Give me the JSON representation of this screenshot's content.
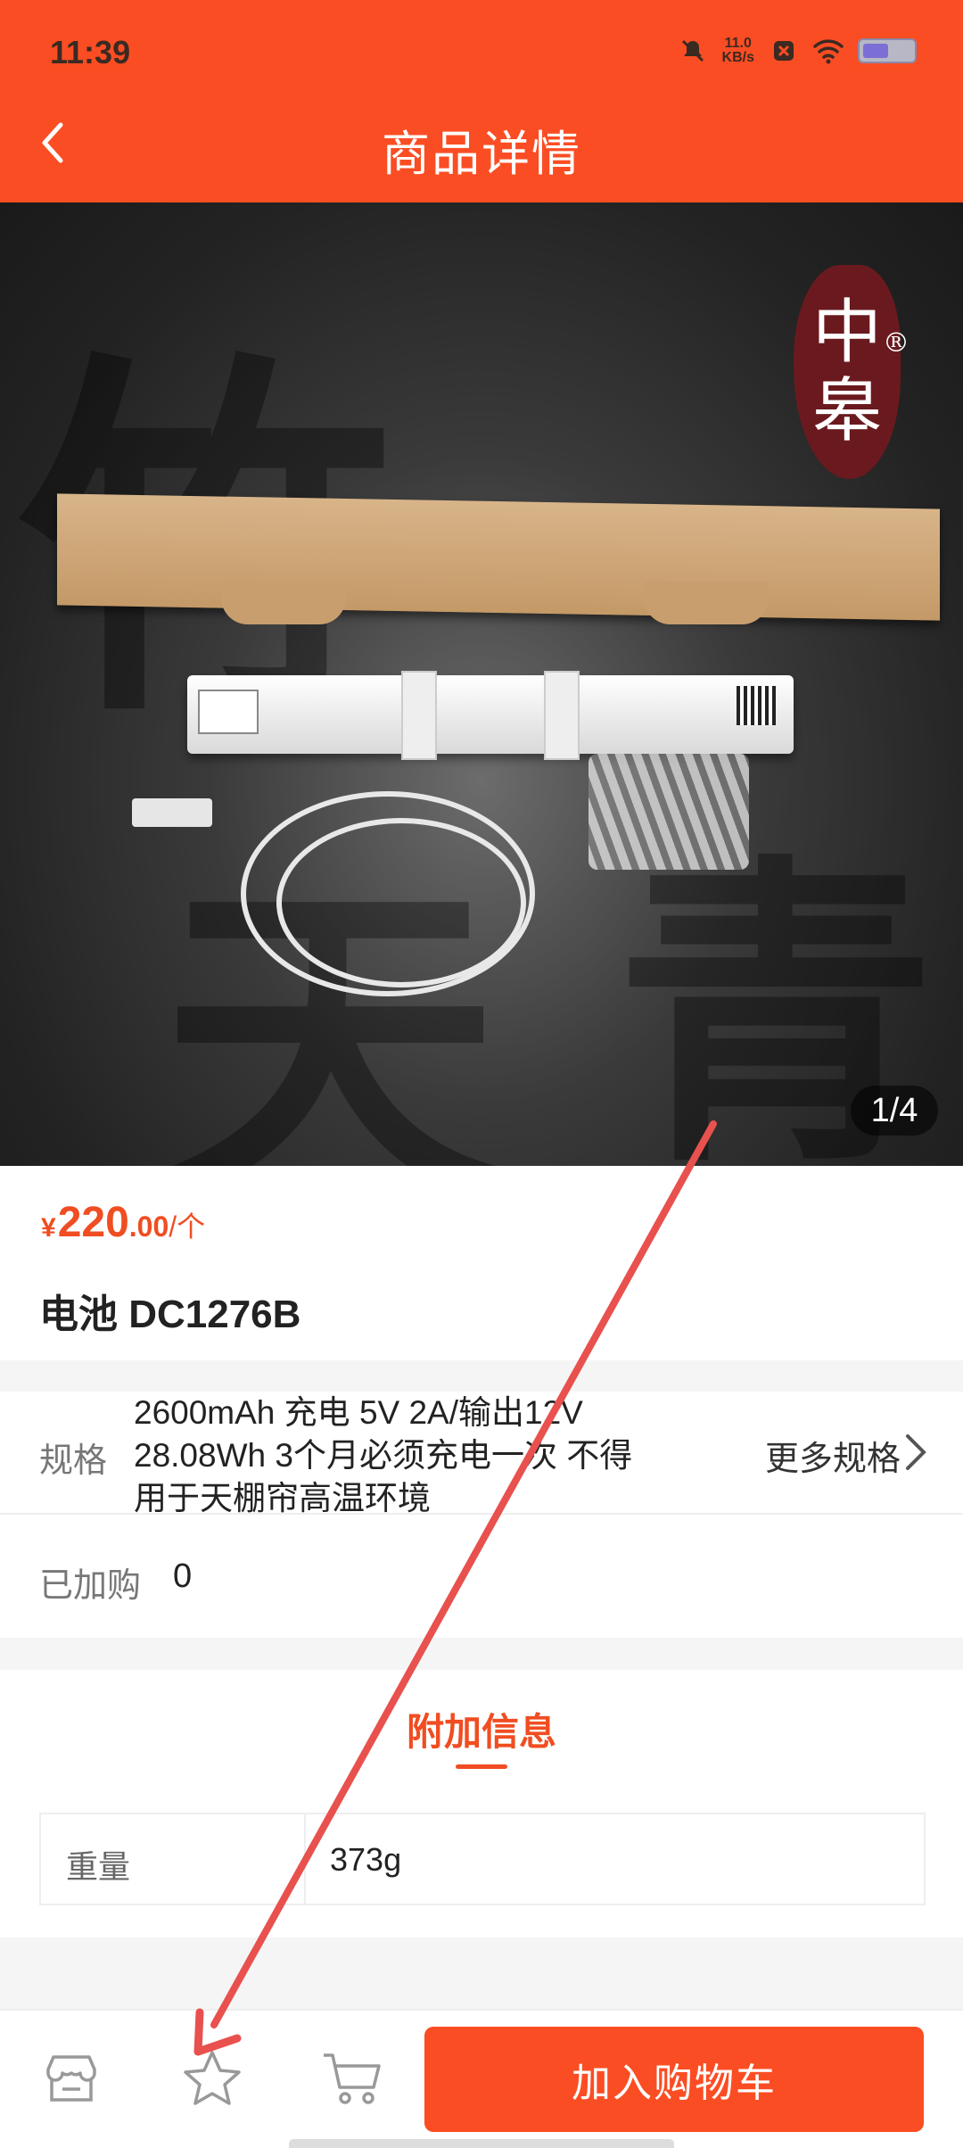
{
  "status_bar": {
    "time": "11:39",
    "net_speed_value": "11.0",
    "net_speed_unit": "KB/s"
  },
  "header": {
    "title": "商品详情"
  },
  "gallery": {
    "counter": "1/4"
  },
  "seal": {
    "line1": "中",
    "line2": "皋",
    "reg": "®"
  },
  "price": {
    "symbol": "¥",
    "integer": "220",
    "decimal": ".00",
    "unit": "/个"
  },
  "product": {
    "name": "电池 DC1276B"
  },
  "spec": {
    "label": "规格",
    "lines": [
      "2600mAh 充电 5V 2A/输出12V",
      "28.08Wh 3个月必须充电一次 不得",
      "用于天棚帘高温环境"
    ],
    "more_label": "更多规格"
  },
  "added": {
    "label": "已加购",
    "value": "0"
  },
  "additional_info": {
    "tab_label": "附加信息",
    "rows": [
      {
        "key": "重量",
        "value": "373g"
      }
    ]
  },
  "bottom_bar": {
    "add_to_cart_label": "加入购物车"
  },
  "icons": [
    "back-icon",
    "mute-icon",
    "wifi-icon",
    "battery-icon",
    "chevron-right-icon",
    "store-icon",
    "star-icon",
    "cart-icon"
  ],
  "colors": {
    "primary": "#fb4d23",
    "price": "#f04d22",
    "annotation_arrow": "#e8514d"
  }
}
